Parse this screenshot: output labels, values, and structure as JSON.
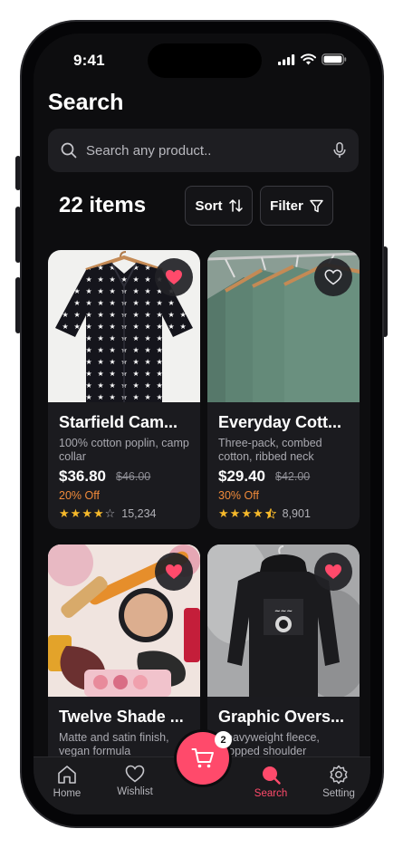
{
  "status": {
    "time": "9:41"
  },
  "page": {
    "title": "Search"
  },
  "search": {
    "placeholder": "Search any product.."
  },
  "results": {
    "count_label": "22 items",
    "sort_label": "Sort",
    "filter_label": "Filter"
  },
  "products": [
    {
      "name": "Starfield Cam...",
      "desc": "100% cotton poplin, camp collar",
      "price": "$36.80",
      "old_price": "$46.00",
      "discount": "20% Off",
      "rating": 4,
      "reviews": "15,234",
      "favorited": true
    },
    {
      "name": "Everyday Cott...",
      "desc": "Three-pack, combed cotton, ribbed neck",
      "price": "$29.40",
      "old_price": "$42.00",
      "discount": "30% Off",
      "rating": 4.5,
      "reviews": "8,901",
      "favorited": false
    },
    {
      "name": "Twelve Shade ...",
      "desc": "Matte and satin finish, vegan formula",
      "favorited": true
    },
    {
      "name": "Graphic Overs...",
      "desc": "Heavyweight fleece, dropped shoulder",
      "favorited": true
    }
  ],
  "tabs": [
    {
      "label": "Home",
      "icon": "home-icon"
    },
    {
      "label": "Wishlist",
      "icon": "heart-icon"
    },
    {
      "label": "Bag",
      "icon": "cart-icon",
      "badge": "2"
    },
    {
      "label": "Search",
      "icon": "search-icon",
      "active": true
    },
    {
      "label": "Setting",
      "icon": "gear-icon"
    }
  ],
  "colors": {
    "accent": "#ff4a6b",
    "discount": "#f08a3a",
    "star": "#f6b92b",
    "background": "#0d0d0f",
    "card": "#1b1b1f"
  }
}
